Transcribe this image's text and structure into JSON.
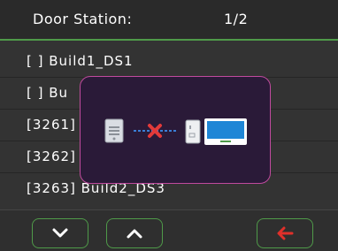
{
  "header": {
    "title": "Door Station:",
    "page": "1/2"
  },
  "rows": [
    {
      "label": "[ ] Build1_DS1"
    },
    {
      "label": "[ ] Bu"
    },
    {
      "label": "[3261]"
    },
    {
      "label": "[3262]"
    },
    {
      "label": "[3263] Build2_DS3"
    }
  ],
  "popup": {
    "icons": [
      "door-station-device-icon",
      "disconnected-link-icon",
      "indoor-monitor-icon"
    ],
    "status": "connection-failed"
  },
  "footer": {
    "icons": [
      "chevron-down-icon",
      "chevron-up-icon",
      "back-arrow-icon"
    ]
  },
  "colors": {
    "accent_green": "#4f9a49",
    "back_red": "#e0302a",
    "popup_border": "#c04a9e",
    "monitor_blue": "#1f86d6",
    "error_x": "#e23a3a"
  }
}
